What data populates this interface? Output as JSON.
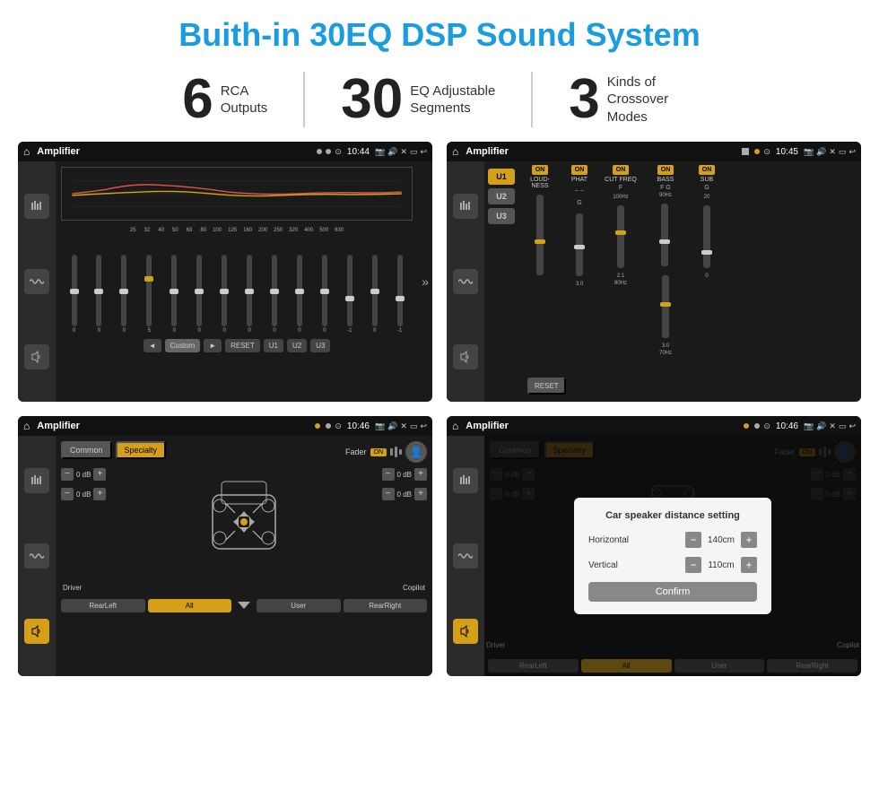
{
  "header": {
    "title": "Buith-in 30EQ DSP Sound System"
  },
  "stats": [
    {
      "number": "6",
      "label": "RCA\nOutputs"
    },
    {
      "number": "30",
      "label": "EQ Adjustable\nSegments"
    },
    {
      "number": "3",
      "label": "Kinds of\nCrossover Modes"
    }
  ],
  "screen1": {
    "appName": "Amplifier",
    "time": "10:44",
    "freqLabels": [
      "25",
      "32",
      "40",
      "50",
      "63",
      "80",
      "100",
      "125",
      "160",
      "200",
      "250",
      "320",
      "400",
      "500",
      "630"
    ],
    "sliderValues": [
      "0",
      "0",
      "0",
      "5",
      "0",
      "0",
      "0",
      "0",
      "0",
      "0",
      "0",
      "-1",
      "0",
      "-1"
    ],
    "buttons": [
      "◄",
      "Custom",
      "►",
      "RESET",
      "U1",
      "U2",
      "U3"
    ]
  },
  "screen2": {
    "appName": "Amplifier",
    "time": "10:45",
    "uButtons": [
      "U1",
      "U2",
      "U3"
    ],
    "controls": [
      "LOUDNESS",
      "PHAT",
      "CUT FREQ",
      "BASS",
      "SUB"
    ],
    "resetLabel": "RESET"
  },
  "screen3": {
    "appName": "Amplifier",
    "time": "10:46",
    "tabs": [
      "Common",
      "Specialty"
    ],
    "faderLabel": "Fader",
    "dbValues": [
      "0 dB",
      "0 dB",
      "0 dB",
      "0 dB"
    ],
    "bottomButtons": [
      "Driver",
      "RearLeft",
      "All",
      "User",
      "Copilot",
      "RearRight"
    ]
  },
  "screen4": {
    "appName": "Amplifier",
    "time": "10:46",
    "tabs": [
      "Common",
      "Specialty"
    ],
    "dialog": {
      "title": "Car speaker distance setting",
      "rows": [
        {
          "label": "Horizontal",
          "value": "140cm"
        },
        {
          "label": "Vertical",
          "value": "110cm"
        }
      ],
      "confirmLabel": "Confirm"
    },
    "bottomButtons": [
      "Driver",
      "RearLeft",
      "All",
      "User",
      "Copilot",
      "RearRight"
    ]
  }
}
